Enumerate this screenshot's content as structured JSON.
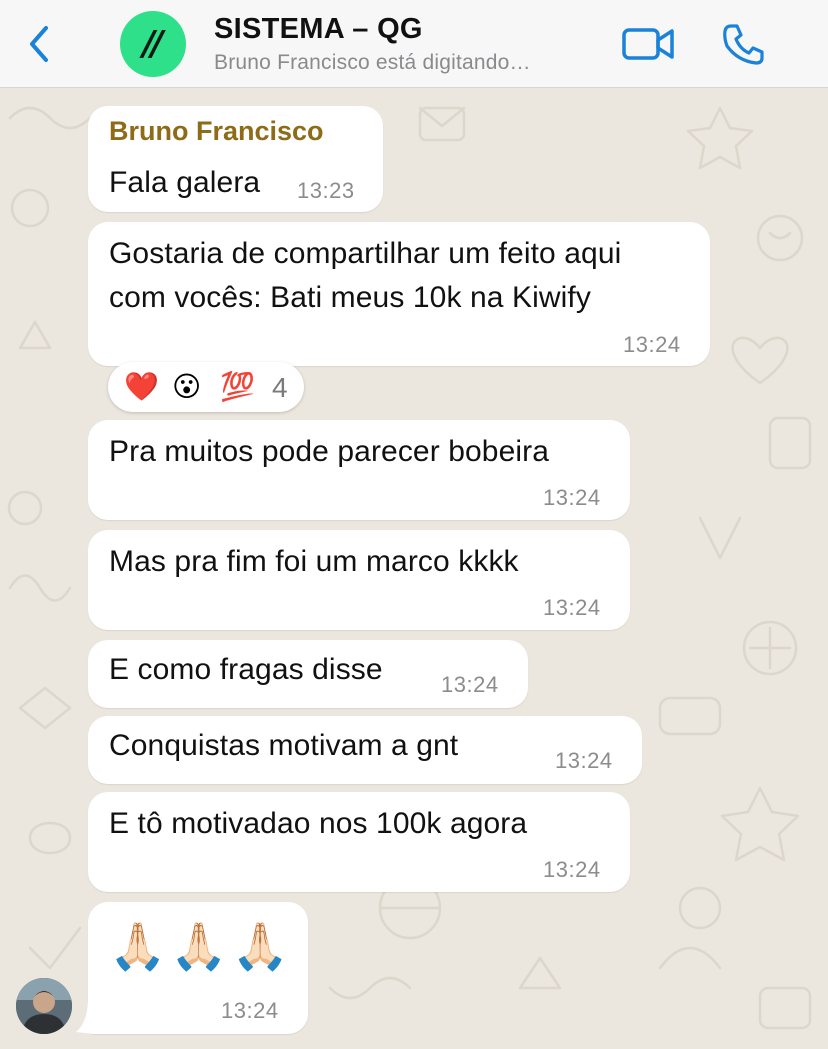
{
  "header": {
    "title": "SISTEMA – QG",
    "subtitle": "Bruno Francisco está digitando…",
    "avatar_text": "//",
    "avatar_color": "#2ee08a",
    "accent_color": "#1a82d9",
    "icons": [
      "chevron-left-icon",
      "video-call-icon",
      "phone-icon"
    ]
  },
  "messages": [
    {
      "sender": "Bruno Francisco",
      "text": "Fala galera",
      "time": "13:23"
    },
    {
      "lines": [
        "Gostaria de compartilhar um feito aqui",
        "com vocês: Bati meus 10k na Kiwify"
      ],
      "time": "13:24",
      "reactions": {
        "emojis": [
          "❤️",
          "😮",
          "💯"
        ],
        "count": "4"
      }
    },
    {
      "text": "Pra muitos pode parecer bobeira",
      "time": "13:24"
    },
    {
      "text": "Mas pra fim foi um marco kkkk",
      "time": "13:24"
    },
    {
      "text": "E como fragas disse",
      "time": "13:24"
    },
    {
      "text": "Conquistas motivam a gnt",
      "time": "13:24"
    },
    {
      "text": "E tô motivadao nos 100k agora",
      "time": "13:24"
    },
    {
      "text": "🙏🏻🙏🏻🙏🏻",
      "time": "13:24"
    }
  ],
  "colors": {
    "sender_name": "#8d6b17",
    "bubble": "#ffffff",
    "wallpaper": "#ebe6de",
    "timestamp": "#8c8c8c"
  }
}
